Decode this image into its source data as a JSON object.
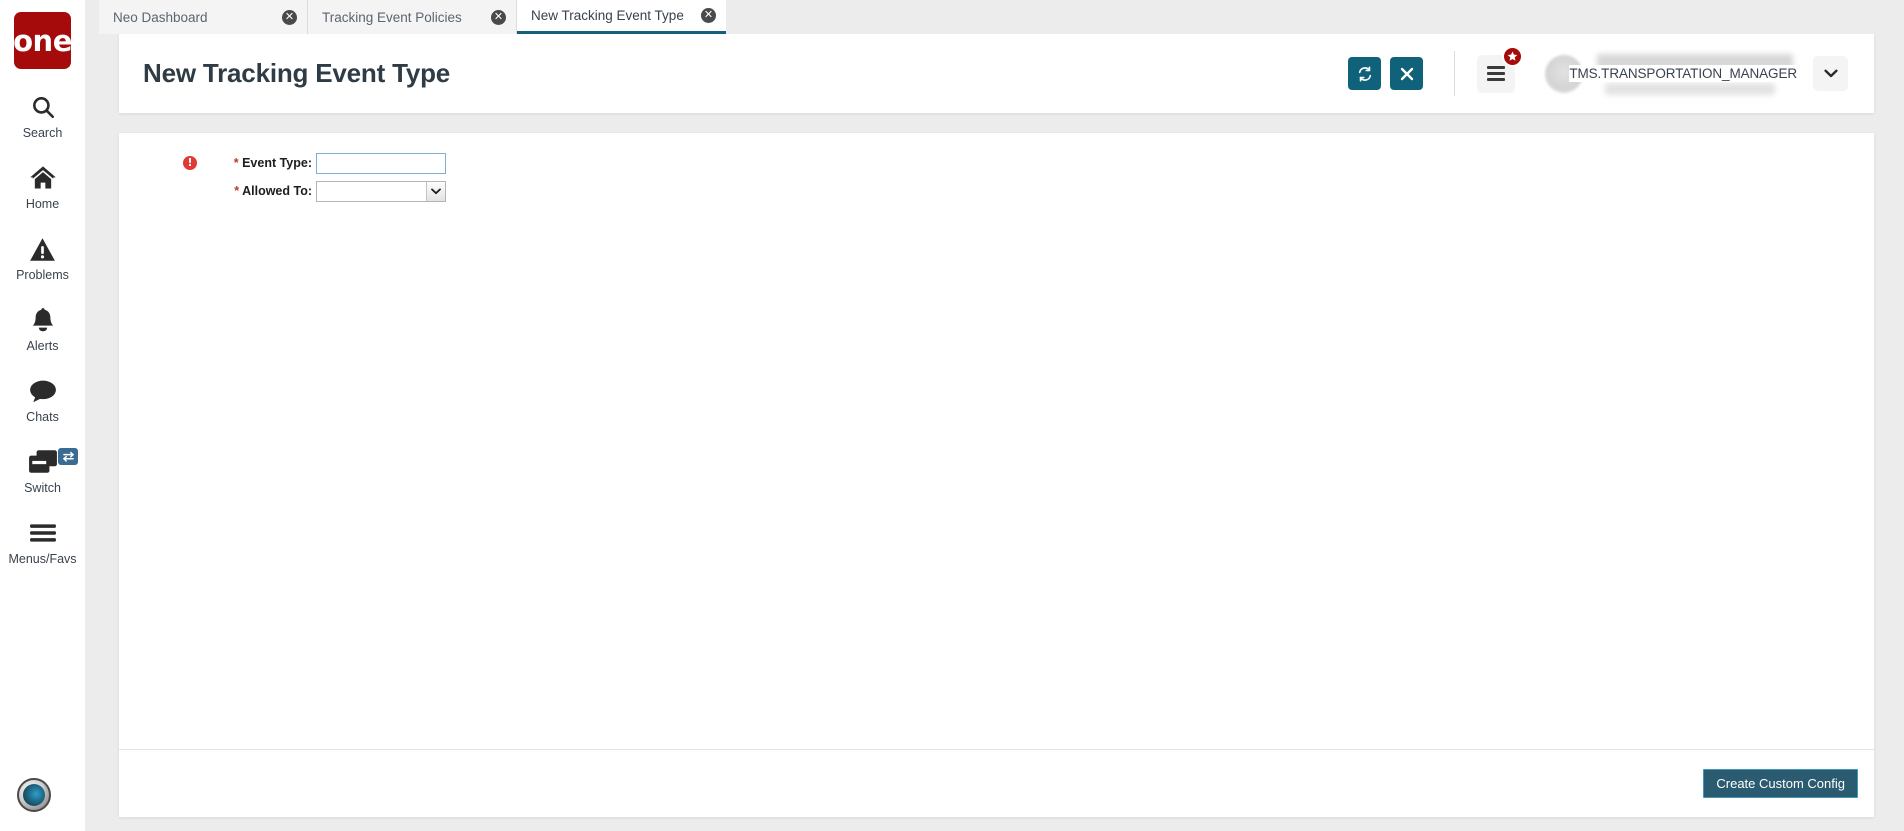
{
  "brand": {
    "logo_text": "one",
    "logo_color": "#a50b0b"
  },
  "sidebar": {
    "items": [
      {
        "label": "Search",
        "icon": "search-icon"
      },
      {
        "label": "Home",
        "icon": "home-icon"
      },
      {
        "label": "Problems",
        "icon": "warning-triangle-icon"
      },
      {
        "label": "Alerts",
        "icon": "bell-icon"
      },
      {
        "label": "Chats",
        "icon": "chat-bubble-icon"
      },
      {
        "label": "Switch",
        "icon": "windows-stack-icon",
        "badge_icon": "swap-arrows-icon"
      },
      {
        "label": "Menus/Favs",
        "icon": "hamburger-icon"
      }
    ],
    "avatar_icon": "user-profile-avatar"
  },
  "tabs": [
    {
      "label": "Neo Dashboard",
      "active": false,
      "close_icon": "close-circle-icon"
    },
    {
      "label": "Tracking Event Policies",
      "active": false,
      "close_icon": "close-circle-icon"
    },
    {
      "label": "New Tracking Event Type",
      "active": true,
      "close_icon": "close-circle-icon"
    }
  ],
  "header": {
    "title": "New Tracking Event Type",
    "refresh_icon": "refresh-icon",
    "close_icon": "close-x-icon",
    "menus_icon": "hamburger-menu-icon",
    "favorites_badge_icon": "star-icon",
    "user_name": "TMS.TRANSPORTATION_MANAGER",
    "user_caret_icon": "chevron-down-icon",
    "accent_color": "#10617a"
  },
  "form": {
    "fields": [
      {
        "label": "Event Type:",
        "required_marker": "*",
        "has_error": true,
        "error_icon": "error-exclamation-icon",
        "type": "text",
        "value": "",
        "placeholder": ""
      },
      {
        "label": "Allowed To:",
        "required_marker": "*",
        "has_error": false,
        "type": "select",
        "value": "",
        "options": [
          ""
        ],
        "dropdown_icon": "chevron-down-icon"
      }
    ]
  },
  "footer": {
    "create_custom_config_label": "Create Custom Config"
  }
}
